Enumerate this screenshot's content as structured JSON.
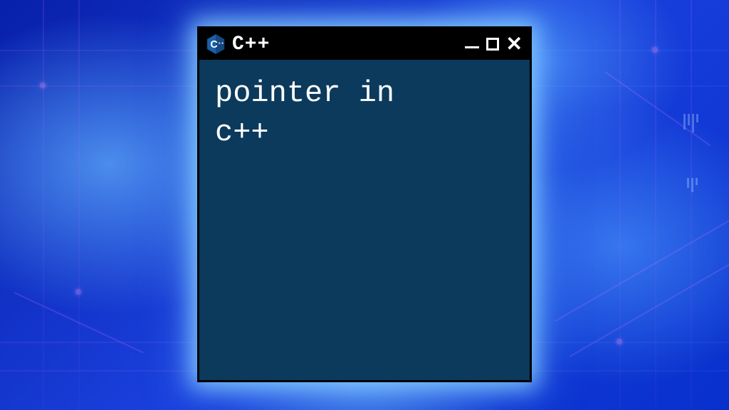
{
  "window": {
    "title": "C++",
    "logo_letter": "C",
    "logo_plus": "++",
    "controls": {
      "minimize_icon": "minimize-icon",
      "maximize_icon": "maximize-icon",
      "close_icon": "close-icon"
    }
  },
  "terminal": {
    "line1": "pointer in",
    "line2": "c++"
  },
  "colors": {
    "window_bg": "#0b3a5c",
    "titlebar_bg": "#000000",
    "text": "#ffffff",
    "glow": "#8cd2ff",
    "logo_hex": "#1b5fa8"
  }
}
